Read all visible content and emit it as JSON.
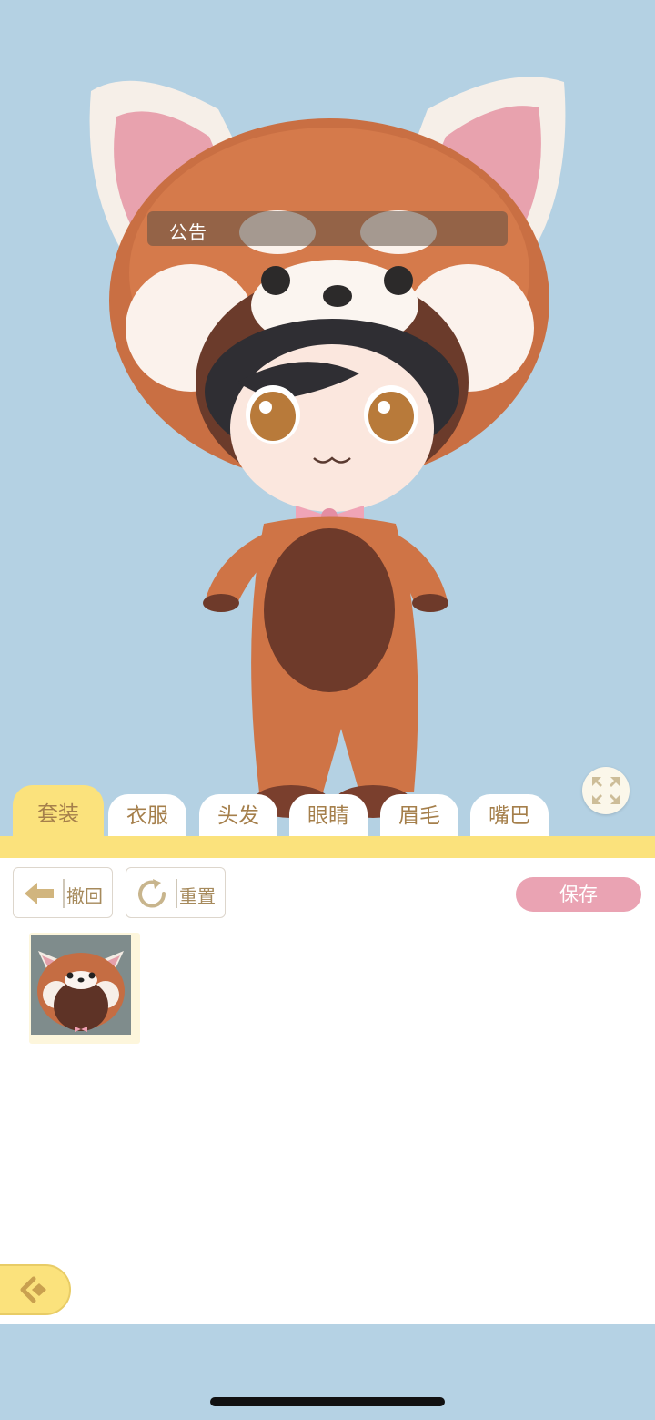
{
  "announcement": {
    "label": "公告"
  },
  "tabs": [
    {
      "label": "套装",
      "active": true
    },
    {
      "label": "衣服",
      "active": false
    },
    {
      "label": "头发",
      "active": false
    },
    {
      "label": "眼睛",
      "active": false
    },
    {
      "label": "眉毛",
      "active": false
    },
    {
      "label": "嘴巴",
      "active": false
    }
  ],
  "toolbar": {
    "undo_label": "撤回",
    "reset_label": "重置",
    "save_label": "保存"
  },
  "icons": {
    "undo": "arrow-left-icon",
    "reset": "refresh-icon",
    "fullscreen": "expand-icon",
    "back": "back-arrow-icon"
  },
  "colors": {
    "background": "#b5d2e4",
    "tab_active": "#fbe27c",
    "tab_text": "#a57f4b",
    "save_button": "#eaa3b3"
  }
}
